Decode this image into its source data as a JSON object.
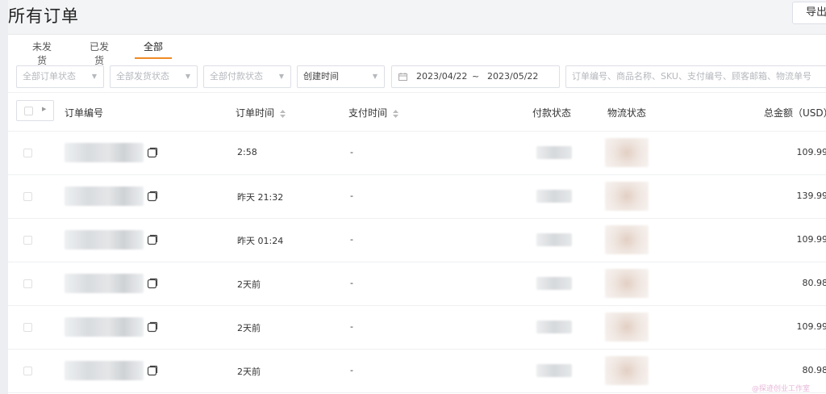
{
  "page": {
    "title": "所有订单",
    "export_label": "导出"
  },
  "tabs": [
    {
      "label": "未发货",
      "active": false
    },
    {
      "label": "已发货",
      "active": false
    },
    {
      "label": "全部",
      "active": true
    }
  ],
  "filters": {
    "order_status": "全部订单状态",
    "ship_status": "全部发货状态",
    "pay_status": "全部付款状态",
    "time_type": "创建时间",
    "date_start": "2023/04/22",
    "date_separator": "~",
    "date_end": "2023/05/22",
    "search_placeholder": "订单编号、商品名称、SKU、支付编号、顾客邮箱、物流单号"
  },
  "table": {
    "headers": {
      "order_no": "订单编号",
      "order_time": "订单时间",
      "pay_time": "支付时间",
      "pay_status": "付款状态",
      "ship_status": "物流状态",
      "total": "总金额（USD）"
    },
    "rows": [
      {
        "order_time": "2:58",
        "pay_time": "-",
        "total": "109.99"
      },
      {
        "order_time": "昨天 21:32",
        "pay_time": "-",
        "total": "139.99"
      },
      {
        "order_time": "昨天 01:24",
        "pay_time": "-",
        "total": "109.99"
      },
      {
        "order_time": "2天前",
        "pay_time": "-",
        "total": "80.98"
      },
      {
        "order_time": "2天前",
        "pay_time": "-",
        "total": "109.99"
      },
      {
        "order_time": "2天前",
        "pay_time": "-",
        "total": "80.98"
      }
    ]
  },
  "watermark": "@探迹创业工作室",
  "colors": {
    "accent": "#f08a24",
    "border": "#dcdfe6"
  }
}
